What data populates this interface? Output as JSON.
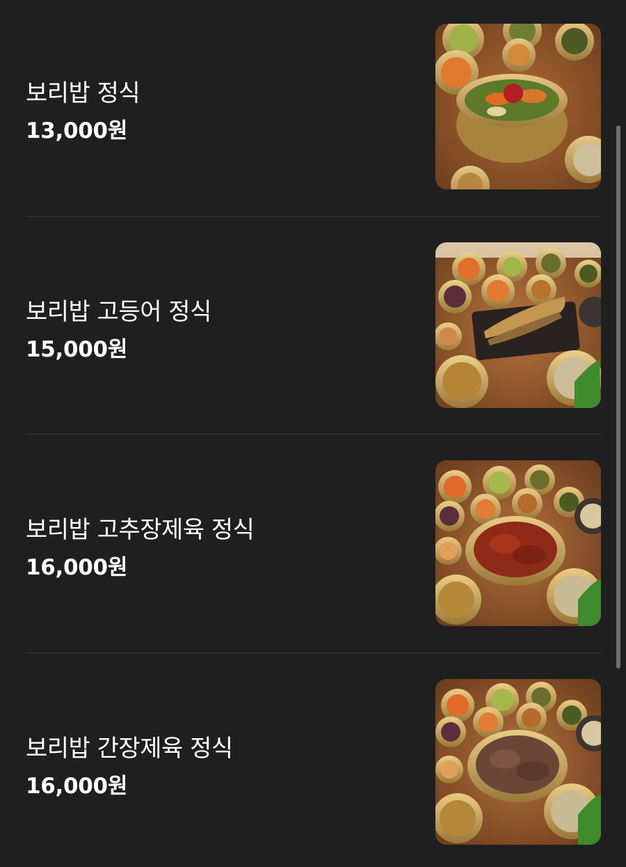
{
  "menu": {
    "items": [
      {
        "name": "보리밥 정식",
        "price": "13,000원",
        "image": "bibimbap-set-photo"
      },
      {
        "name": "보리밥 고등어 정식",
        "price": "15,000원",
        "image": "grilled-mackerel-set-photo"
      },
      {
        "name": "보리밥 고추장제육 정식",
        "price": "16,000원",
        "image": "spicy-pork-set-photo"
      },
      {
        "name": "보리밥 간장제육 정식",
        "price": "16,000원",
        "image": "soy-pork-set-photo"
      }
    ]
  },
  "colors": {
    "background": "#1f1f1f",
    "text": "#ffffff",
    "divider": "#383838",
    "scrollbar": "#6f6f6f"
  }
}
